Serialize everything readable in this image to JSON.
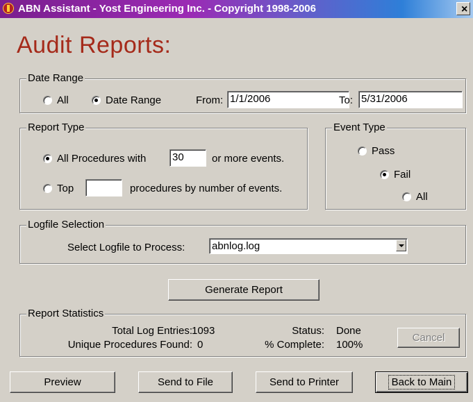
{
  "window": {
    "title": "ABN Assistant - Yost Engineering Inc. - Copyright 1998-2006",
    "close_glyph": "×",
    "heading": "Audit Reports:"
  },
  "date_range": {
    "group_label": "Date Range",
    "option_all": "All",
    "option_range": "Date Range",
    "selected": "range",
    "from_label": "From:",
    "from_value": "1/1/2006",
    "to_label": "To:",
    "to_value": "5/31/2006"
  },
  "report_type": {
    "group_label": "Report Type",
    "selected": "all_procedures",
    "all_procedures_label": "All Procedures with",
    "min_events_value": "30",
    "min_events_suffix": "or more events.",
    "top_label": "Top",
    "top_value": "",
    "top_suffix": "procedures by number of events."
  },
  "event_type": {
    "group_label": "Event Type",
    "option_pass": "Pass",
    "option_fail": "Fail",
    "option_all": "All",
    "selected": "fail"
  },
  "logfile": {
    "group_label": "Logfile Selection",
    "select_label": "Select Logfile to Process:",
    "selected_value": "abnlog.log"
  },
  "generate_button": "Generate Report",
  "stats": {
    "group_label": "Report Statistics",
    "total_label": "Total Log Entries:",
    "total_value": "1093",
    "unique_label": "Unique Procedures Found:",
    "unique_value": "0",
    "status_label": "Status:",
    "status_value": "Done",
    "complete_label": "% Complete:",
    "complete_value": "100%",
    "cancel_button": "Cancel"
  },
  "footer": {
    "preview": "Preview",
    "send_to_file": "Send to File",
    "send_to_printer": "Send to Printer",
    "back_to_main": "Back to Main"
  },
  "colors": {
    "heading": "#a52a1a",
    "window_bg": "#d4d0c8",
    "titlebar_start": "#7a1f8e",
    "titlebar_end": "#a6caf0"
  },
  "icons": {
    "app": "abn-app-icon",
    "close": "close-icon",
    "dropdown": "chevron-down-icon"
  }
}
